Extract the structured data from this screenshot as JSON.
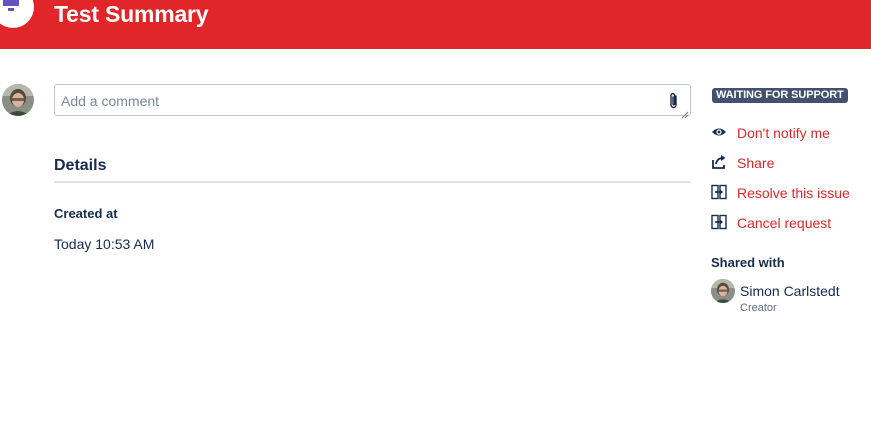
{
  "header": {
    "title": "Test Summary",
    "background_color": "#e02628",
    "icon": "request-type-icon"
  },
  "comment": {
    "placeholder": "Add a comment",
    "attach_icon": "paperclip-icon"
  },
  "details": {
    "heading": "Details",
    "created_label": "Created at",
    "created_value": "Today 10:53 AM"
  },
  "sidebar": {
    "status": "WAITING FOR SUPPORT",
    "status_color": "#42526e",
    "link_color": "#d52a2a",
    "actions": [
      {
        "label": "Don't notify me",
        "icon": "eye-icon"
      },
      {
        "label": "Share",
        "icon": "share-icon"
      },
      {
        "label": "Resolve this issue",
        "icon": "transition-icon"
      },
      {
        "label": "Cancel request",
        "icon": "transition-icon"
      }
    ],
    "shared_with": {
      "heading": "Shared with",
      "name": "Simon Carlstedt",
      "role": "Creator"
    }
  }
}
